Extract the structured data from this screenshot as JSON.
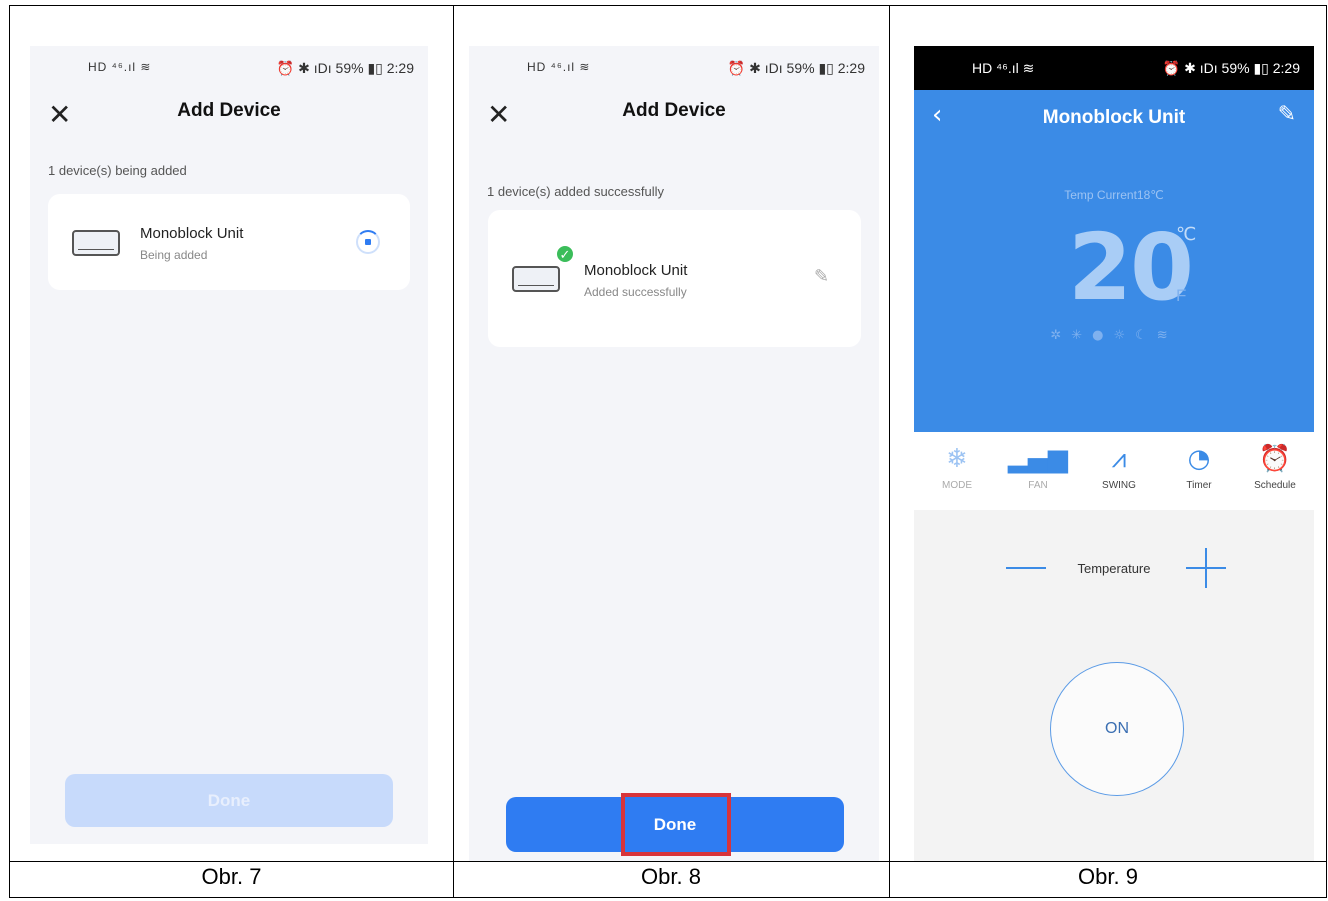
{
  "captions": [
    "Obr. 7",
    "Obr. 8",
    "Obr. 9"
  ],
  "statusbar": {
    "left": "HD ⁴⁶.ıl ≋",
    "right": "⏰ ✱ ıDı 59% ▮▯ 2:29"
  },
  "screen1": {
    "title": "Add Device",
    "status_line": "1 device(s) being added",
    "device_name": "Monoblock Unit",
    "device_status": "Being added",
    "button_label": "Done"
  },
  "screen2": {
    "title": "Add Device",
    "status_line": "1 device(s) added successfully",
    "device_name": "Monoblock Unit",
    "device_status": "Added successfully",
    "button_label": "Done"
  },
  "screen3": {
    "title": "Monoblock Unit",
    "temp_current": "Temp Current18℃",
    "set_temp": "20",
    "unit_c": "℃",
    "unit_f": "F",
    "tabs": [
      {
        "label": "MODE",
        "icon": "snowflake-icon"
      },
      {
        "label": "FAN",
        "icon": "fan-bars-icon"
      },
      {
        "label": "SWING",
        "icon": "swing-icon"
      },
      {
        "label": "Timer",
        "icon": "clock-icon"
      },
      {
        "label": "Schedule",
        "icon": "alarm-clock-icon"
      }
    ],
    "temperature_label": "Temperature",
    "power_label": "ON"
  },
  "colors": {
    "accent": "#2f7cf2",
    "header_blue": "#3b8be6",
    "success": "#3bbd5a",
    "highlight": "#d8343a"
  }
}
